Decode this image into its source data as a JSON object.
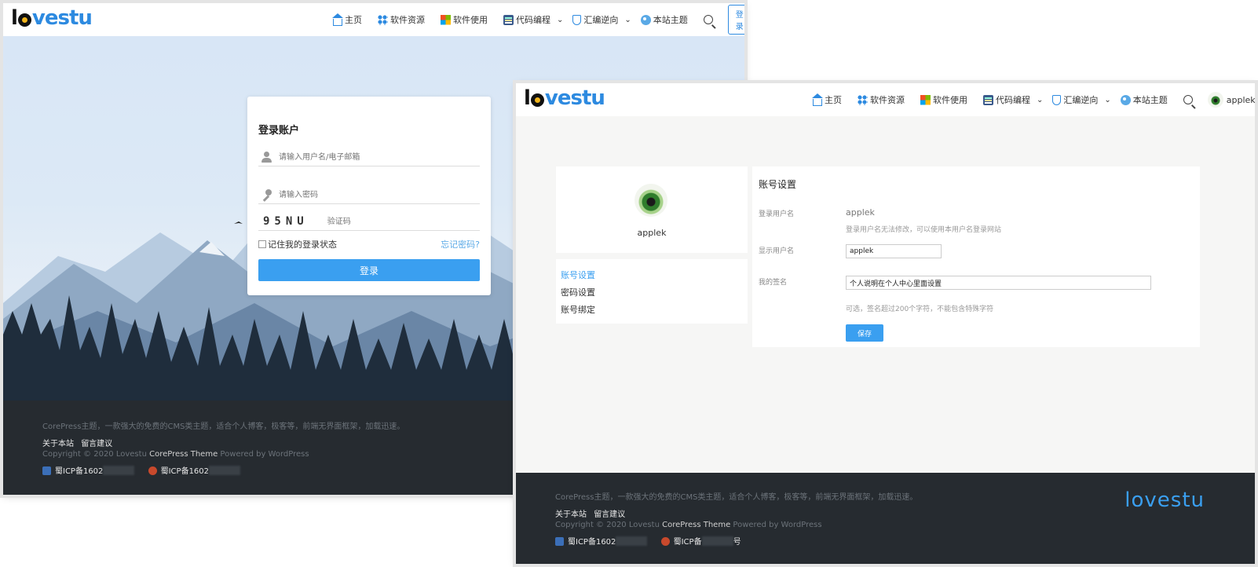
{
  "site": {
    "logo_text": "lovestu",
    "nav": [
      {
        "label": "主页",
        "icon": "home-icon"
      },
      {
        "label": "软件资源",
        "icon": "grid-icon"
      },
      {
        "label": "软件使用",
        "icon": "windows-icon"
      },
      {
        "label": "代码编程",
        "icon": "code-icon",
        "dropdown": true
      },
      {
        "label": "汇编逆向",
        "icon": "shield-icon",
        "dropdown": true
      },
      {
        "label": "本站主题",
        "icon": "palette-icon"
      }
    ],
    "login_button": "登录",
    "user_name": "applek"
  },
  "login": {
    "title": "登录账户",
    "username_placeholder": "请输入用户名/电子邮箱",
    "password_placeholder": "请输入密码",
    "captcha_text": "95NU",
    "captcha_placeholder": "验证码",
    "remember_label": "记住我的登录状态",
    "forgot_label": "忘记密码?",
    "submit_label": "登录"
  },
  "account": {
    "username": "applek",
    "menu": [
      "账号设置",
      "密码设置",
      "账号绑定"
    ],
    "form_title": "账号设置",
    "login_username_label": "登录用户名",
    "login_username_value": "applek",
    "login_username_hint": "登录用户名无法修改，可以使用本用户名登录网站",
    "display_name_label": "显示用户名",
    "display_name_value": "applek",
    "signature_label": "我的签名",
    "signature_value": "个人说明在个人中心里面设置",
    "signature_hint": "可选，签名超过200个字符，不能包含特殊字符",
    "save_label": "保存"
  },
  "footer": {
    "desc": "CorePress主题，一款强大的免费的CMS类主题，适合个人博客，极客等，前端无界面框架，加载迅速。",
    "links": [
      "关于本站",
      "留言建议"
    ],
    "copyright_prefix": "Copyright © 2020 Lovestu",
    "copyright_theme": "CorePress Theme",
    "copyright_suffix": "Powered by WordPress",
    "icp1": "蜀ICP备1602",
    "icp2": "蜀ICP备1602",
    "icp1_b": "蜀ICP备1602",
    "icp2_b": "蜀ICP备",
    "icp2_b_suffix": "号",
    "logo_text": "lovestu"
  }
}
